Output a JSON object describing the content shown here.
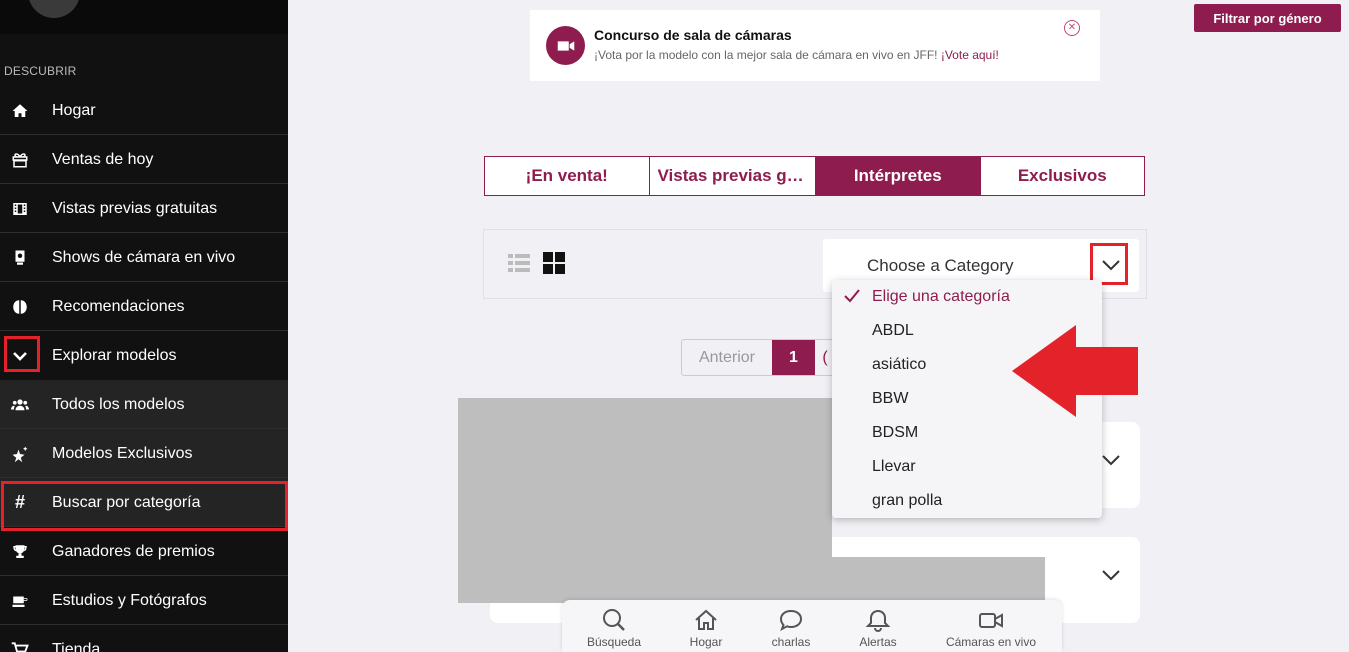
{
  "sidebar": {
    "section_title": "DESCUBRIR",
    "items": [
      {
        "label": "Hogar",
        "icon": "home-icon"
      },
      {
        "label": "Ventas de hoy",
        "icon": "gift-icon"
      },
      {
        "label": "Vistas previas gratuitas",
        "icon": "film-icon"
      },
      {
        "label": "Shows de cámara en vivo",
        "icon": "webcam-icon"
      },
      {
        "label": "Recomendaciones",
        "icon": "brain-icon"
      },
      {
        "label": "Explorar modelos",
        "icon": "chevron-down-icon"
      },
      {
        "label": "Todos los modelos",
        "icon": "users-icon"
      },
      {
        "label": "Modelos Exclusivos",
        "icon": "star-icon"
      },
      {
        "label": "Buscar por categoría",
        "icon": "hash-icon"
      },
      {
        "label": "Ganadores de premios",
        "icon": "trophy-icon"
      },
      {
        "label": "Estudios y Fotógrafos",
        "icon": "camera-icon"
      },
      {
        "label": "Tienda",
        "icon": "cart-icon"
      }
    ]
  },
  "contest": {
    "title": "Concurso de sala de cámaras",
    "description": "¡Vota por la modelo con la mejor sala de cámara en vivo en JFF!",
    "link": "¡Vote aquí!",
    "close": "✕"
  },
  "filter_button": "Filtrar por género",
  "tabs": [
    {
      "label": "¡En venta!",
      "active": false
    },
    {
      "label": "Vistas previas gratuitas",
      "active": false
    },
    {
      "label": "Intérpretes",
      "active": true
    },
    {
      "label": "Exclusivos",
      "active": false
    }
  ],
  "category_select": {
    "placeholder": "Choose a Category",
    "options": [
      "Elige una categoría",
      "ABDL",
      "asiático",
      "BBW",
      "BDSM",
      "Llevar",
      "gran polla"
    ],
    "selected_index": 0
  },
  "pagination": {
    "prev": "Anterior",
    "current": "1",
    "next_partial": "("
  },
  "bottom_nav": [
    {
      "label": "Búsqueda",
      "icon": "search-icon"
    },
    {
      "label": "Hogar",
      "icon": "home-icon"
    },
    {
      "label": "charlas",
      "icon": "chat-icon"
    },
    {
      "label": "Alertas",
      "icon": "bell-icon"
    },
    {
      "label": "Cámaras en vivo",
      "icon": "video-camera-icon"
    }
  ],
  "colors": {
    "brand": "#8e1c4f",
    "highlight": "#e3222a",
    "sidebar_bg": "#111111"
  }
}
